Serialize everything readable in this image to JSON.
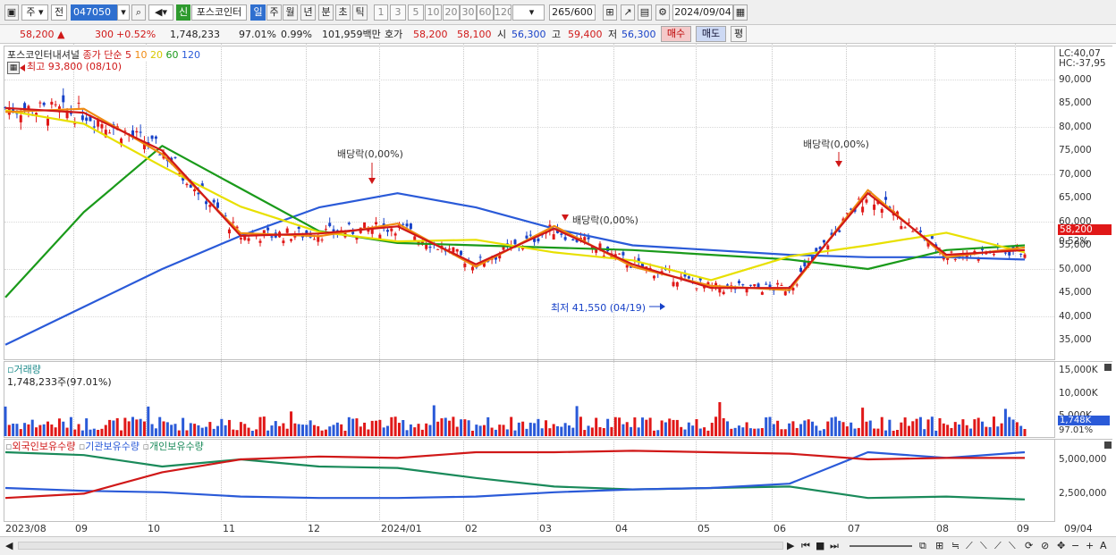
{
  "toolbar": {
    "week_label": "주",
    "prev_label": "전",
    "code": "047050",
    "stock_name": "포스코인터",
    "periods": [
      "일",
      "주",
      "월",
      "년",
      "분",
      "초",
      "틱"
    ],
    "intervals": [
      "1",
      "3",
      "5",
      "10",
      "20",
      "30",
      "60",
      "120"
    ],
    "count": "265",
    "count_max": "/600",
    "date": "2024/09/04",
    "credit_badge": "신"
  },
  "quote": {
    "price": "58,200",
    "arrow": "▲",
    "change": "300",
    "change_pct": "+0.52%",
    "volume": "1,748,233",
    "vol_ratio": "97.01%",
    "turnover": "0.99%",
    "amount": "101,959백만",
    "ask_label": "호가",
    "ask": "58,200",
    "bid": "58,100",
    "open_label": "시",
    "open": "56,300",
    "high_label": "고",
    "high": "59,400",
    "low_label": "저",
    "low": "56,300",
    "buy": "매수",
    "sell": "매도",
    "eval": "평"
  },
  "price_pane": {
    "name": "포스코인터내셔널",
    "ma_label": "종가 단순",
    "ma_periods": [
      "5",
      "10",
      "20",
      "60",
      "120"
    ],
    "ma_colors": [
      "#d01818",
      "#f08a10",
      "#e8e000",
      "#1a9a1a",
      "#2a5ad8"
    ],
    "high_note": "최고 93,800 (08/10)",
    "low_note": "최저 41,550 (04/19)",
    "dividend_note": "배당락(0,00%)",
    "lc": "LC:40,07",
    "hc": "HC:-37,95",
    "last_price": "58,200",
    "last_pct": "0.52%",
    "y_ticks": [
      "90,000",
      "85,000",
      "80,000",
      "75,000",
      "70,000",
      "65,000",
      "60,000",
      "55,000",
      "50,000",
      "45,000",
      "40,000",
      "35,000"
    ]
  },
  "volume_pane": {
    "title": "거래량",
    "info": "1,748,233주(97.01%)",
    "y_ticks": [
      "15,000K",
      "10,000K",
      "5,000K"
    ],
    "last": "1,748K",
    "last_pct": "97.01%"
  },
  "holding_pane": {
    "series": [
      "외국인보유수량",
      "기관보유수량",
      "개인보유수량"
    ],
    "y_ticks": [
      "5,000,000",
      "2,500,000"
    ]
  },
  "x_ticks": [
    "2023/08",
    "09",
    "10",
    "11",
    "12",
    "2024/01",
    "02",
    "03",
    "04",
    "05",
    "06",
    "07",
    "08",
    "09",
    "09/04"
  ],
  "chart_data": {
    "type": "line",
    "title": "포스코인터내셔널",
    "x": [
      "2023/08",
      "09",
      "10",
      "11",
      "12",
      "2024/01",
      "02",
      "03",
      "04",
      "05",
      "06",
      "07",
      "08",
      "09",
      "09/04"
    ],
    "ylim": [
      33000,
      95000
    ],
    "series": [
      {
        "name": "종가",
        "values": [
          84000,
          83000,
          75000,
          57000,
          57500,
          59000,
          51000,
          58500,
          51000,
          46000,
          46000,
          66000,
          53000,
          54000,
          58200
        ]
      },
      {
        "name": "60",
        "values": [
          44000,
          62000,
          76000,
          67000,
          58000,
          55500,
          55000,
          54500,
          54000,
          53000,
          52000,
          50000,
          54000,
          55000,
          56000
        ]
      },
      {
        "name": "120",
        "values": [
          34000,
          42000,
          50000,
          57000,
          63000,
          66000,
          63000,
          58500,
          55000,
          54000,
          53000,
          52500,
          52500,
          52000,
          52000
        ]
      }
    ],
    "annotations": [
      "최고 93,800 (08/10)",
      "최저 41,550 (04/19)",
      "배당락(0,00%)"
    ]
  }
}
